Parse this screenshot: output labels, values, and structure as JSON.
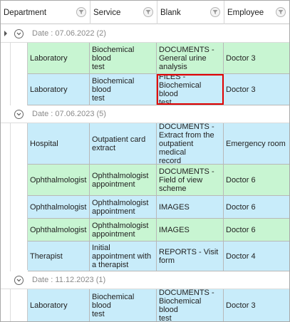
{
  "columns": [
    {
      "label": "Department",
      "key": "department"
    },
    {
      "label": "Service",
      "key": "service"
    },
    {
      "label": "Blank",
      "key": "blank"
    },
    {
      "label": "Employee",
      "key": "employee"
    }
  ],
  "groups": [
    {
      "label": "Date : 07.06.2022 (2)",
      "rows": [
        {
          "department": "Laboratory",
          "service": "Biochemical blood\ntest",
          "blank": "DOCUMENTS -\nGeneral urine\nanalysis",
          "employee": "Doctor 3",
          "color": "green"
        },
        {
          "department": "Laboratory",
          "service": "Biochemical blood\ntest",
          "blank": "FILES -\nBiochemical blood\ntest",
          "employee": "Doctor 3",
          "color": "blue",
          "selected": true
        }
      ]
    },
    {
      "label": "Date : 07.06.2023 (5)",
      "rows": [
        {
          "department": "Hospital",
          "service": "Outpatient card\nextract",
          "blank": "DOCUMENTS -\nExtract from the\noutpatient medical\nrecord",
          "employee": "Emergency room",
          "color": "blue"
        },
        {
          "department": "Ophthalmologist",
          "service": "Ophthalmologist\nappointment",
          "blank": "DOCUMENTS -\nField of view\nscheme",
          "employee": "Doctor 6",
          "color": "green"
        },
        {
          "department": "Ophthalmologist",
          "service": "Ophthalmologist\nappointment",
          "blank": "IMAGES",
          "employee": "Doctor 6",
          "color": "blue"
        },
        {
          "department": "Ophthalmologist",
          "service": "Ophthalmologist\nappointment",
          "blank": "IMAGES",
          "employee": "Doctor 6",
          "color": "green"
        },
        {
          "department": "Therapist",
          "service": "Initial\nappointment with\na therapist",
          "blank": "REPORTS - Visit\nform",
          "employee": "Doctor 4",
          "color": "blue"
        }
      ]
    },
    {
      "label": "Date : 11.12.2023 (1)",
      "rows": [
        {
          "department": "Laboratory",
          "service": "Biochemical blood\ntest",
          "blank": "DOCUMENTS -\nBiochemical blood\ntest",
          "employee": "Doctor 3",
          "color": "blue"
        }
      ]
    }
  ],
  "colors": {
    "row_green": "#c8f5d2",
    "row_blue": "#c8ecfa",
    "selection": "#e00000"
  }
}
